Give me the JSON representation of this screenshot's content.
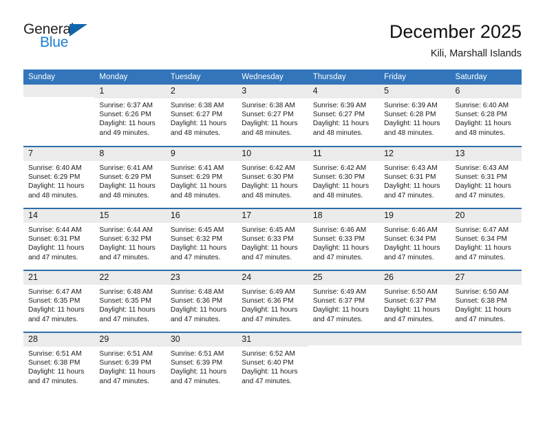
{
  "brand": {
    "name_top": "General",
    "name_bottom": "Blue",
    "accent_color": "#1b7fd4",
    "triangle_color": "#1165ad"
  },
  "header": {
    "title": "December 2025",
    "subtitle": "Kili, Marshall Islands"
  },
  "theme": {
    "header_bar": "#3275bb",
    "row_divider": "#2e6da8",
    "daynum_band": "#ebebeb",
    "text": "#1a1a1a"
  },
  "calendar": {
    "weekdays": [
      "Sunday",
      "Monday",
      "Tuesday",
      "Wednesday",
      "Thursday",
      "Friday",
      "Saturday"
    ],
    "weeks": [
      [
        {
          "day": "",
          "sunrise": "",
          "sunset": "",
          "daylight": ""
        },
        {
          "day": "1",
          "sunrise": "Sunrise: 6:37 AM",
          "sunset": "Sunset: 6:26 PM",
          "daylight": "Daylight: 11 hours and 49 minutes."
        },
        {
          "day": "2",
          "sunrise": "Sunrise: 6:38 AM",
          "sunset": "Sunset: 6:27 PM",
          "daylight": "Daylight: 11 hours and 48 minutes."
        },
        {
          "day": "3",
          "sunrise": "Sunrise: 6:38 AM",
          "sunset": "Sunset: 6:27 PM",
          "daylight": "Daylight: 11 hours and 48 minutes."
        },
        {
          "day": "4",
          "sunrise": "Sunrise: 6:39 AM",
          "sunset": "Sunset: 6:27 PM",
          "daylight": "Daylight: 11 hours and 48 minutes."
        },
        {
          "day": "5",
          "sunrise": "Sunrise: 6:39 AM",
          "sunset": "Sunset: 6:28 PM",
          "daylight": "Daylight: 11 hours and 48 minutes."
        },
        {
          "day": "6",
          "sunrise": "Sunrise: 6:40 AM",
          "sunset": "Sunset: 6:28 PM",
          "daylight": "Daylight: 11 hours and 48 minutes."
        }
      ],
      [
        {
          "day": "7",
          "sunrise": "Sunrise: 6:40 AM",
          "sunset": "Sunset: 6:29 PM",
          "daylight": "Daylight: 11 hours and 48 minutes."
        },
        {
          "day": "8",
          "sunrise": "Sunrise: 6:41 AM",
          "sunset": "Sunset: 6:29 PM",
          "daylight": "Daylight: 11 hours and 48 minutes."
        },
        {
          "day": "9",
          "sunrise": "Sunrise: 6:41 AM",
          "sunset": "Sunset: 6:29 PM",
          "daylight": "Daylight: 11 hours and 48 minutes."
        },
        {
          "day": "10",
          "sunrise": "Sunrise: 6:42 AM",
          "sunset": "Sunset: 6:30 PM",
          "daylight": "Daylight: 11 hours and 48 minutes."
        },
        {
          "day": "11",
          "sunrise": "Sunrise: 6:42 AM",
          "sunset": "Sunset: 6:30 PM",
          "daylight": "Daylight: 11 hours and 48 minutes."
        },
        {
          "day": "12",
          "sunrise": "Sunrise: 6:43 AM",
          "sunset": "Sunset: 6:31 PM",
          "daylight": "Daylight: 11 hours and 47 minutes."
        },
        {
          "day": "13",
          "sunrise": "Sunrise: 6:43 AM",
          "sunset": "Sunset: 6:31 PM",
          "daylight": "Daylight: 11 hours and 47 minutes."
        }
      ],
      [
        {
          "day": "14",
          "sunrise": "Sunrise: 6:44 AM",
          "sunset": "Sunset: 6:31 PM",
          "daylight": "Daylight: 11 hours and 47 minutes."
        },
        {
          "day": "15",
          "sunrise": "Sunrise: 6:44 AM",
          "sunset": "Sunset: 6:32 PM",
          "daylight": "Daylight: 11 hours and 47 minutes."
        },
        {
          "day": "16",
          "sunrise": "Sunrise: 6:45 AM",
          "sunset": "Sunset: 6:32 PM",
          "daylight": "Daylight: 11 hours and 47 minutes."
        },
        {
          "day": "17",
          "sunrise": "Sunrise: 6:45 AM",
          "sunset": "Sunset: 6:33 PM",
          "daylight": "Daylight: 11 hours and 47 minutes."
        },
        {
          "day": "18",
          "sunrise": "Sunrise: 6:46 AM",
          "sunset": "Sunset: 6:33 PM",
          "daylight": "Daylight: 11 hours and 47 minutes."
        },
        {
          "day": "19",
          "sunrise": "Sunrise: 6:46 AM",
          "sunset": "Sunset: 6:34 PM",
          "daylight": "Daylight: 11 hours and 47 minutes."
        },
        {
          "day": "20",
          "sunrise": "Sunrise: 6:47 AM",
          "sunset": "Sunset: 6:34 PM",
          "daylight": "Daylight: 11 hours and 47 minutes."
        }
      ],
      [
        {
          "day": "21",
          "sunrise": "Sunrise: 6:47 AM",
          "sunset": "Sunset: 6:35 PM",
          "daylight": "Daylight: 11 hours and 47 minutes."
        },
        {
          "day": "22",
          "sunrise": "Sunrise: 6:48 AM",
          "sunset": "Sunset: 6:35 PM",
          "daylight": "Daylight: 11 hours and 47 minutes."
        },
        {
          "day": "23",
          "sunrise": "Sunrise: 6:48 AM",
          "sunset": "Sunset: 6:36 PM",
          "daylight": "Daylight: 11 hours and 47 minutes."
        },
        {
          "day": "24",
          "sunrise": "Sunrise: 6:49 AM",
          "sunset": "Sunset: 6:36 PM",
          "daylight": "Daylight: 11 hours and 47 minutes."
        },
        {
          "day": "25",
          "sunrise": "Sunrise: 6:49 AM",
          "sunset": "Sunset: 6:37 PM",
          "daylight": "Daylight: 11 hours and 47 minutes."
        },
        {
          "day": "26",
          "sunrise": "Sunrise: 6:50 AM",
          "sunset": "Sunset: 6:37 PM",
          "daylight": "Daylight: 11 hours and 47 minutes."
        },
        {
          "day": "27",
          "sunrise": "Sunrise: 6:50 AM",
          "sunset": "Sunset: 6:38 PM",
          "daylight": "Daylight: 11 hours and 47 minutes."
        }
      ],
      [
        {
          "day": "28",
          "sunrise": "Sunrise: 6:51 AM",
          "sunset": "Sunset: 6:38 PM",
          "daylight": "Daylight: 11 hours and 47 minutes."
        },
        {
          "day": "29",
          "sunrise": "Sunrise: 6:51 AM",
          "sunset": "Sunset: 6:39 PM",
          "daylight": "Daylight: 11 hours and 47 minutes."
        },
        {
          "day": "30",
          "sunrise": "Sunrise: 6:51 AM",
          "sunset": "Sunset: 6:39 PM",
          "daylight": "Daylight: 11 hours and 47 minutes."
        },
        {
          "day": "31",
          "sunrise": "Sunrise: 6:52 AM",
          "sunset": "Sunset: 6:40 PM",
          "daylight": "Daylight: 11 hours and 47 minutes."
        },
        {
          "day": "",
          "sunrise": "",
          "sunset": "",
          "daylight": ""
        },
        {
          "day": "",
          "sunrise": "",
          "sunset": "",
          "daylight": ""
        },
        {
          "day": "",
          "sunrise": "",
          "sunset": "",
          "daylight": ""
        }
      ]
    ]
  }
}
